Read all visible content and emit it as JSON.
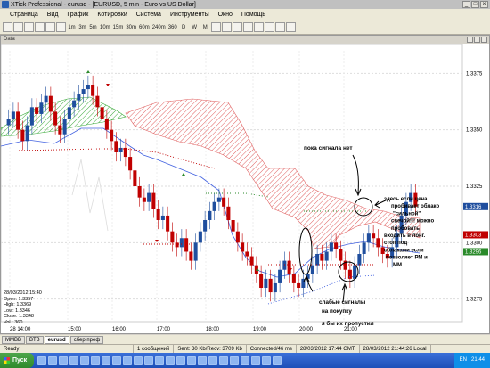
{
  "window": {
    "title": "XTick Professional - eurusd - [EURUSD, 5 min - Euro vs US Dollar]",
    "chart_window_title": "Data"
  },
  "menu": [
    "Страница",
    "Вид",
    "График",
    "Котировки",
    "Система",
    "Инструменты",
    "Окно",
    "Помощь"
  ],
  "toolbar": {
    "timeframes": [
      "1m",
      "3m",
      "5m",
      "10m",
      "15m",
      "30m",
      "60m",
      "240m",
      "360",
      "D",
      "W",
      "M"
    ]
  },
  "chart": {
    "price_ticks": [
      "1.3375",
      "1.3350",
      "1.3325",
      "1.3300",
      "1.3275"
    ],
    "price_current_label": "1.3316",
    "price_red_label": "1.3303",
    "price_green_label": "1.3296",
    "time_ticks": [
      "28 14:00",
      "15:00",
      "16:00",
      "17:00",
      "18:00",
      "19:00",
      "20:00",
      "21:00"
    ],
    "annotations": {
      "no_signal": "пока сигнала нет",
      "breakout": "здесь если цена пробивает облако \"сильной\" свечой!!! можно пробовать входить в лонг. стоп под облаками если позволяет РМ и ММ",
      "weak_signals": "слабые сигналы на покупку",
      "skip": "я бы их пропустил"
    }
  },
  "infobox": {
    "date": "28/03/2012 15:40",
    "open": "Open: 1.3357",
    "high": "High: 1.3369",
    "low": "Low: 1.3346",
    "close": "Close: 1.3348",
    "vol": "Vol.: 360"
  },
  "tabs": [
    "MMBB",
    "BTB",
    "eurusd",
    "сбер преф"
  ],
  "status": {
    "ready": "Ready",
    "messages": "1 сообщений",
    "traffic": "Sent: 30 Kb/Recv: 3709 Kb",
    "latency": "Connected/46 ms",
    "gmt_time": "28/03/2012 17:44 GMT",
    "local_time": "28/03/2012 21:44:26 Local"
  },
  "taskbar": {
    "start_label": "Пуск",
    "lang": "EN",
    "clock": "21:44"
  },
  "colors": {
    "bull": "#1f4e9e",
    "bear": "#c00000",
    "cloud_red": "#e06060",
    "cloud_green": "#3aaa3a",
    "kijun": "#ff9090",
    "tenkan": "#4060e0"
  }
}
